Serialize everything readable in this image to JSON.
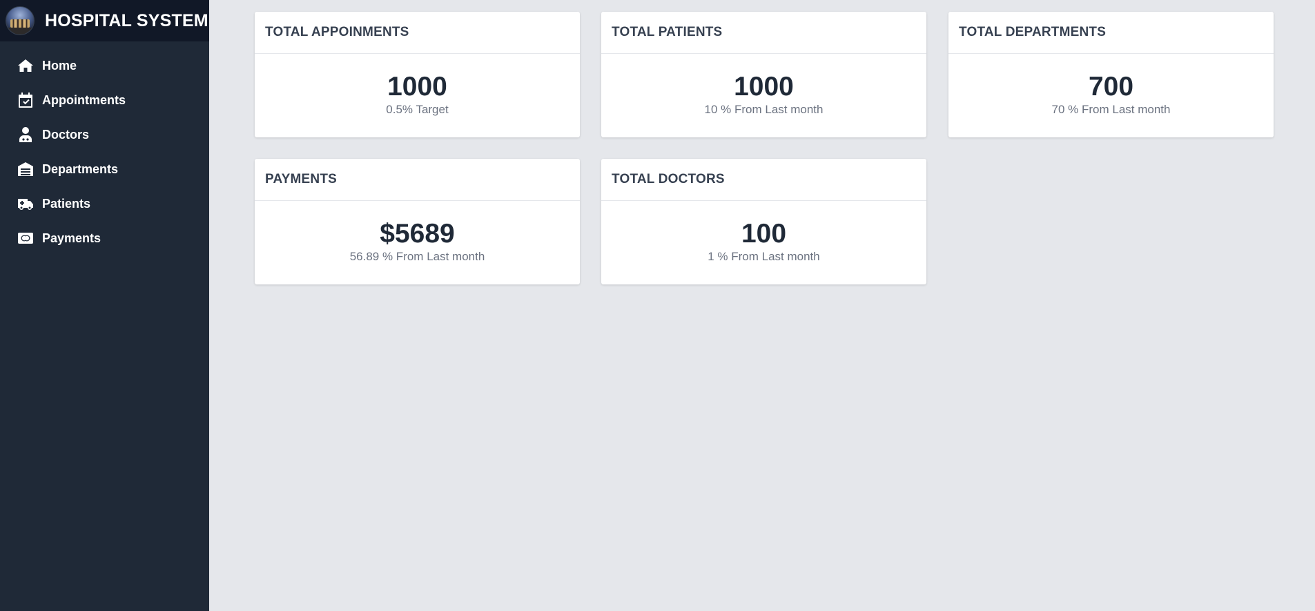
{
  "brand": {
    "title": "HOSPITAL SYSTEM"
  },
  "sidebar": {
    "items": [
      {
        "label": "Home",
        "icon": "home-icon"
      },
      {
        "label": "Appointments",
        "icon": "calendar-check-icon"
      },
      {
        "label": "Doctors",
        "icon": "doctor-icon"
      },
      {
        "label": "Departments",
        "icon": "building-icon"
      },
      {
        "label": "Patients",
        "icon": "ambulance-icon"
      },
      {
        "label": "Payments",
        "icon": "card-icon"
      }
    ]
  },
  "cards": [
    {
      "title": "TOTAL APPOINMENTS",
      "value": "1000",
      "sub": "0.5% Target"
    },
    {
      "title": "TOTAL PATIENTS",
      "value": "1000",
      "sub": "10 % From Last month"
    },
    {
      "title": "TOTAL DEPARTMENTS",
      "value": "700",
      "sub": "70 % From Last month"
    },
    {
      "title": "PAYMENTS",
      "value": "$5689",
      "sub": "56.89 % From Last month"
    },
    {
      "title": "TOTAL DOCTORS",
      "value": "100",
      "sub": "1 % From Last month"
    }
  ],
  "colors": {
    "sidebar_bg": "#1f2937",
    "brand_bg": "#111827",
    "page_bg": "#e5e7eb",
    "card_bg": "#ffffff"
  }
}
